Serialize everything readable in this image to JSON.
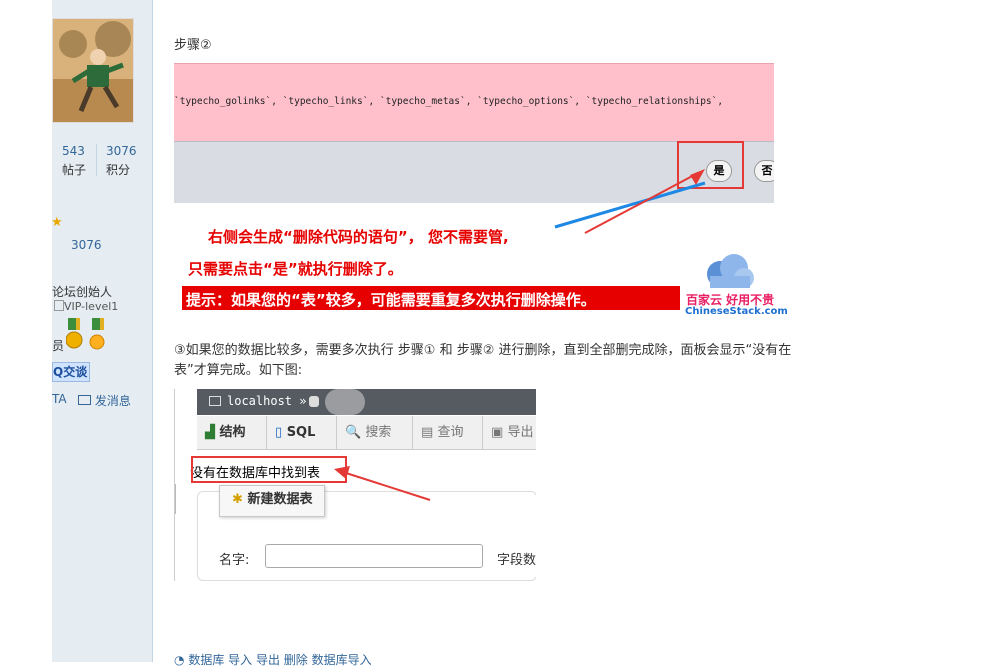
{
  "sidebar": {
    "posts_count": "543",
    "posts_label": "帖子",
    "points_count": "3076",
    "points_label": "积分",
    "points_value": "3076",
    "role": "论坛创始人",
    "vip_alt": "VIP-level1",
    "member_suffix": "员",
    "qq_button": "Q交谈",
    "ta_link": "TA",
    "message_link": "发消息"
  },
  "post": {
    "step2_title": "步骤②",
    "sql_text": "`typecho_golinks`, `typecho_links`, `typecho_metas`, `typecho_options`, `typecho_relationships`,",
    "yes_button": "是",
    "no_button": "否",
    "annotation_line1": "右侧会生成“删除代码的语句”， 您不需要管,",
    "annotation_line2": "只需要点击“是”就执行删除了。",
    "tip": "提示：如果您的“表”较多，可能需要重复多次执行删除操作。",
    "watermark_cn": "百家云 好用不贵",
    "watermark_en": "ChineseStack.com",
    "para_line1": "③如果您的数据比较多，需要多次执行 步骤① 和 步骤② 进行删除，直到全部删完成除，面板会显示“没有在",
    "para_line2": "表”才算完成。如下图:"
  },
  "pma": {
    "server": "localhost »",
    "tabs": [
      "结构",
      "SQL",
      "搜索",
      "查询",
      "导出"
    ],
    "no_tables_msg": "没有在数据库中找到表",
    "new_table_button": "新建数据表",
    "name_label": "名字:",
    "name_value": "",
    "fields_label": "字段数"
  },
  "footer": {
    "links": "数据库  导入  导出  删除  数据库导入"
  },
  "colors": {
    "sidebar_bg": "#e5edf2",
    "pink": "#ffc0cb",
    "annotation_red": "#e60000",
    "arrow_blue": "#1e88e5",
    "link": "#336699"
  }
}
